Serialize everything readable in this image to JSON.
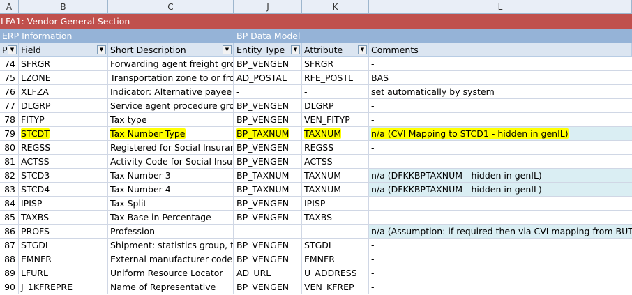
{
  "columns": [
    "A",
    "B",
    "C",
    "J",
    "K",
    "L"
  ],
  "sheet_title": "LFA1: Vendor General Section",
  "sections": {
    "left": "ERP Information",
    "right": "BP Data Model"
  },
  "headers": {
    "p": "P",
    "field": "Field",
    "short_desc": "Short Description",
    "entity": "Entity Type",
    "attribute": "Attribute",
    "comments": "Comments"
  },
  "rows": [
    {
      "num": "74",
      "field": "SFRGR",
      "desc": "Forwarding agent freight group",
      "entity": "BP_VENGEN",
      "attr": "SFRGR",
      "comment": "-"
    },
    {
      "num": "75",
      "field": "LZONE",
      "desc": "Transportation zone to or from which",
      "entity": "AD_POSTAL",
      "attr": "RFE_POSTL",
      "comment": "BAS"
    },
    {
      "num": "76",
      "field": "XLFZA",
      "desc": "Indicator: Alternative payee",
      "entity": "-",
      "attr": "-",
      "comment": "set automatically by system"
    },
    {
      "num": "77",
      "field": "DLGRP",
      "desc": "Service agent procedure group",
      "entity": "BP_VENGEN",
      "attr": "DLGRP",
      "comment": "-"
    },
    {
      "num": "78",
      "field": "FITYP",
      "desc": "Tax type",
      "entity": "BP_VENGEN",
      "attr": "VEN_FITYP",
      "comment": "-"
    },
    {
      "num": "79",
      "field": "STCDT",
      "desc": "Tax Number Type",
      "entity": "BP_TAXNUM",
      "attr": "TAXNUM",
      "comment": "n/a (CVI Mapping to STCD1 - hidden in genIL)"
    },
    {
      "num": "80",
      "field": "REGSS",
      "desc": "Registered for Social Insurance",
      "entity": "BP_VENGEN",
      "attr": "REGSS",
      "comment": "-"
    },
    {
      "num": "81",
      "field": "ACTSS",
      "desc": "Activity Code for Social Insurance",
      "entity": "BP_VENGEN",
      "attr": "ACTSS",
      "comment": "-"
    },
    {
      "num": "82",
      "field": "STCD3",
      "desc": "Tax Number 3",
      "entity": "BP_TAXNUM",
      "attr": "TAXNUM",
      "comment": "n/a (DFKKBPTAXNUM - hidden in genIL)"
    },
    {
      "num": "83",
      "field": "STCD4",
      "desc": "Tax Number 4",
      "entity": "BP_TAXNUM",
      "attr": "TAXNUM",
      "comment": "n/a (DFKKBPTAXNUM - hidden in genIL)"
    },
    {
      "num": "84",
      "field": "IPISP",
      "desc": "Tax Split",
      "entity": "BP_VENGEN",
      "attr": "IPISP",
      "comment": "-"
    },
    {
      "num": "85",
      "field": "TAXBS",
      "desc": "Tax Base in Percentage",
      "entity": "BP_VENGEN",
      "attr": "TAXBS",
      "comment": "-"
    },
    {
      "num": "86",
      "field": "PROFS",
      "desc": "Profession",
      "entity": "-",
      "attr": "-",
      "comment": "n/a (Assumption: if required then via CVI mapping from BUTO"
    },
    {
      "num": "87",
      "field": "STGDL",
      "desc": "Shipment: statistics group, transport",
      "entity": "BP_VENGEN",
      "attr": "STGDL",
      "comment": "-"
    },
    {
      "num": "88",
      "field": "EMNFR",
      "desc": "External manufacturer code name",
      "entity": "BP_VENGEN",
      "attr": "EMNFR",
      "comment": "-"
    },
    {
      "num": "89",
      "field": "LFURL",
      "desc": "Uniform Resource Locator",
      "entity": "AD_URL",
      "attr": "U_ADDRESS",
      "comment": "-"
    },
    {
      "num": "90",
      "field": "J_1KFREPRE",
      "desc": "Name of Representative",
      "entity": "BP_VENGEN",
      "attr": "VEN_KFREP",
      "comment": "-"
    }
  ],
  "colors": {
    "title_bar": "#c0504d",
    "section_bar": "#95b3d7",
    "header_row": "#dbe5f1",
    "highlight": "#ffff00",
    "comment_fill": "#daeef3"
  }
}
